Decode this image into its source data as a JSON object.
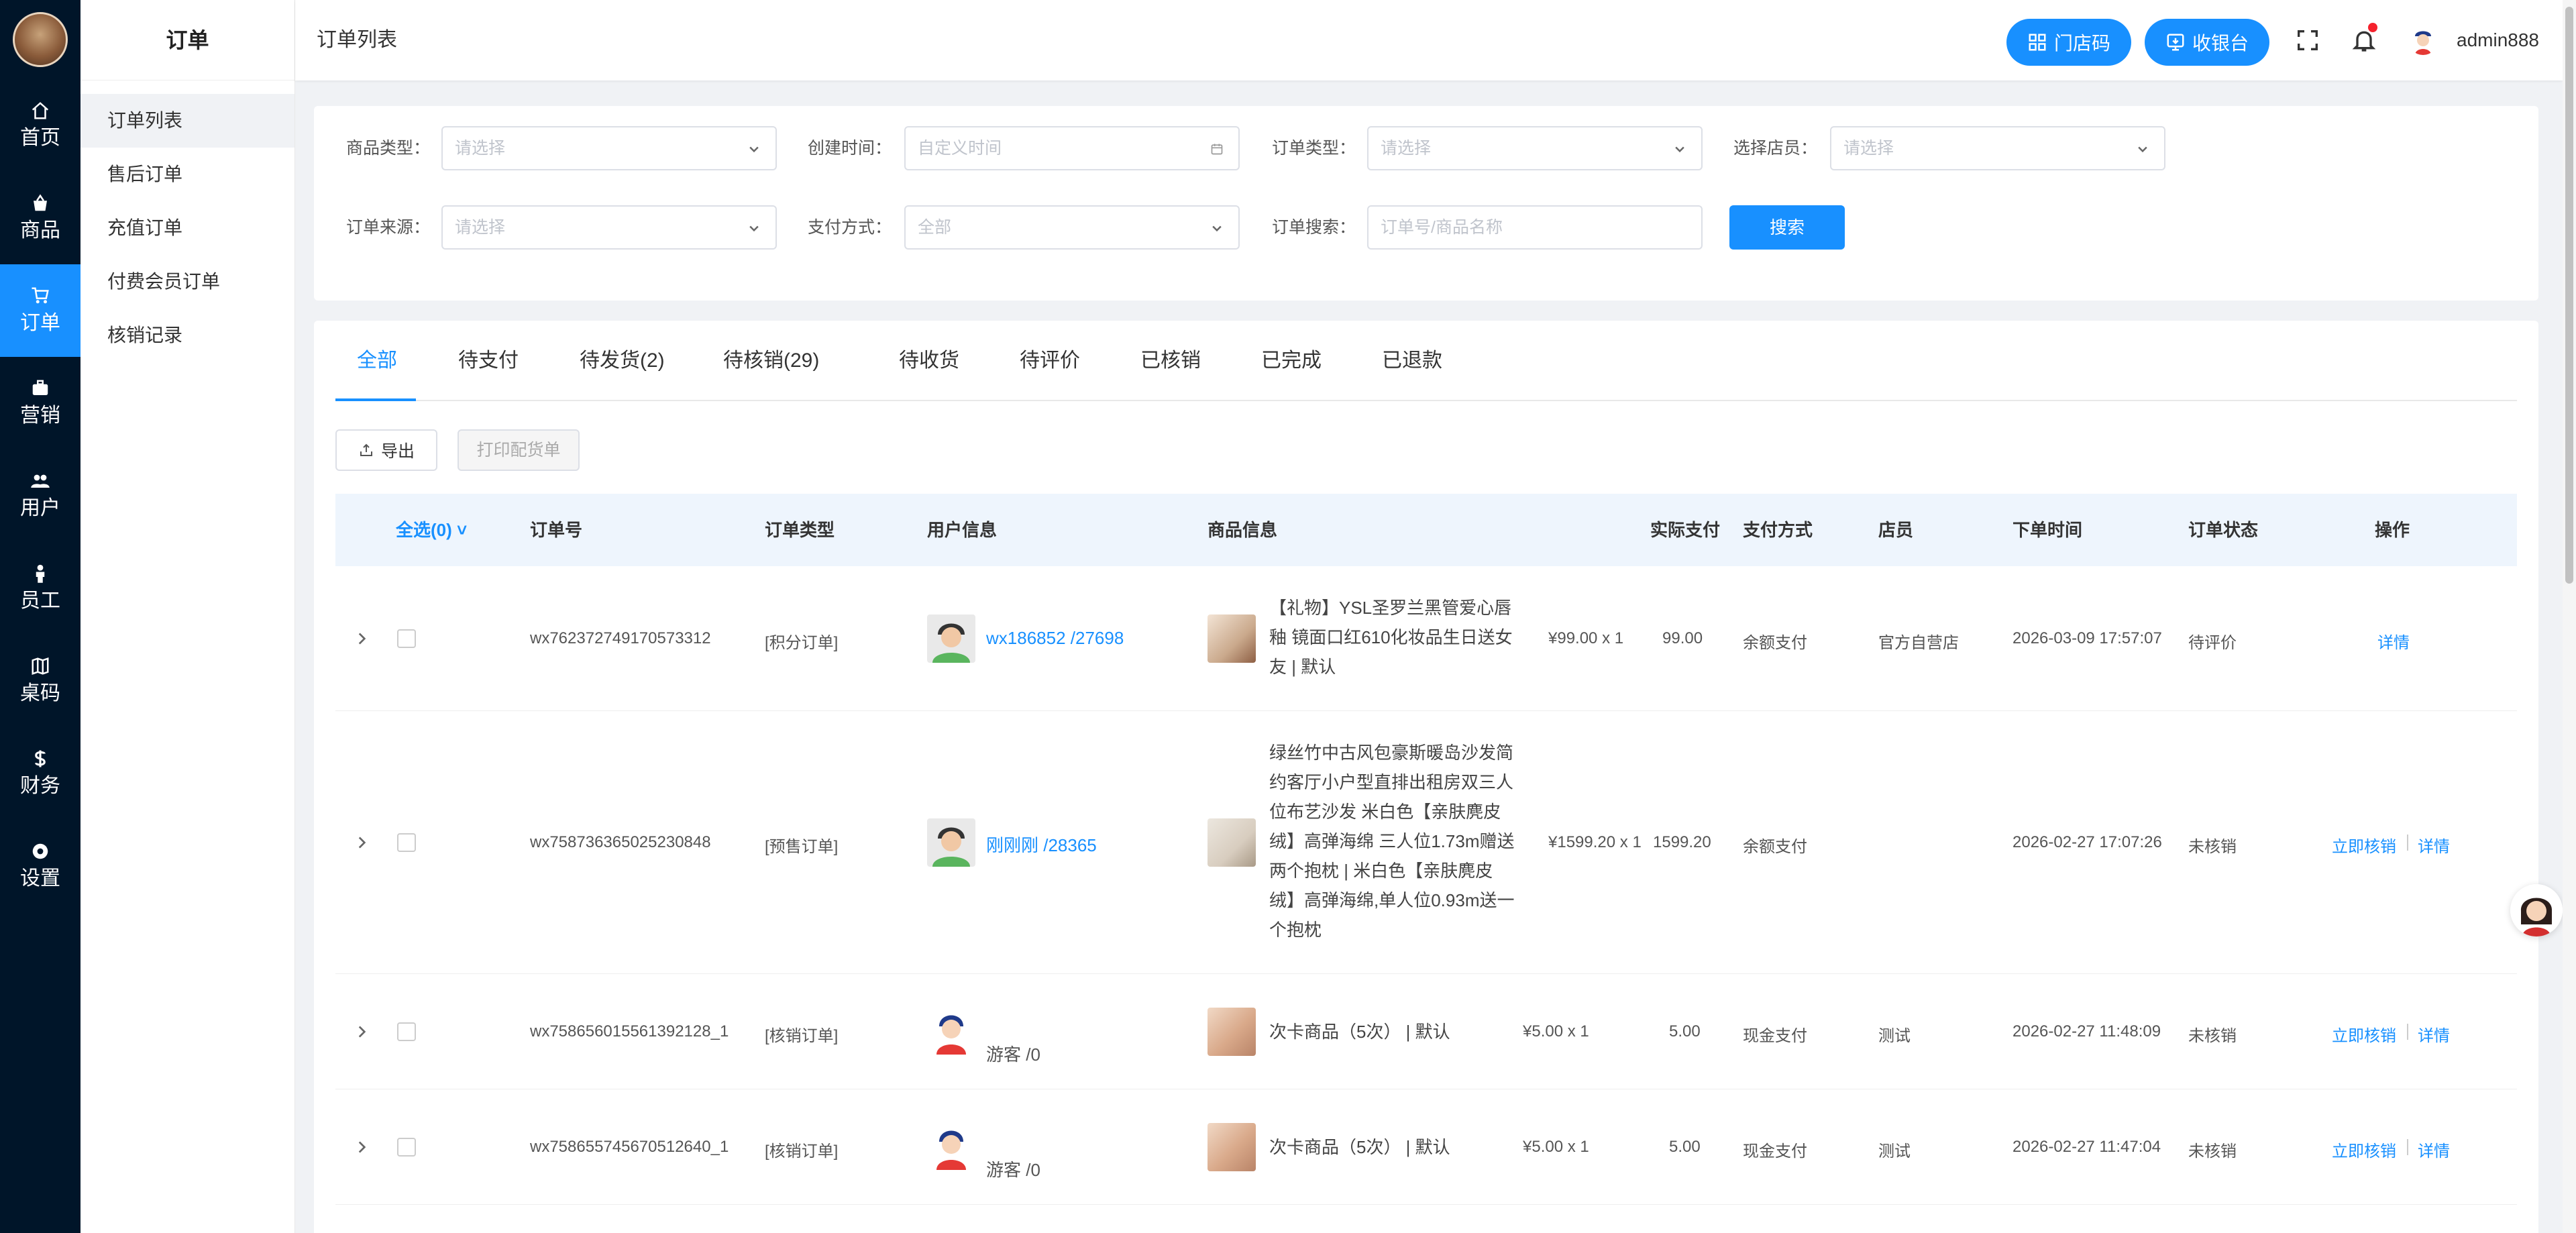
{
  "app": {
    "section_title": "订单",
    "page_title": "订单列表"
  },
  "sidebar": {
    "items": [
      {
        "label": "首页",
        "icon": "home-icon"
      },
      {
        "label": "商品",
        "icon": "shopping-bag-icon"
      },
      {
        "label": "订单",
        "icon": "cart-icon",
        "active": true
      },
      {
        "label": "营销",
        "icon": "briefcase-icon"
      },
      {
        "label": "用户",
        "icon": "users-icon"
      },
      {
        "label": "员工",
        "icon": "person-icon"
      },
      {
        "label": "桌码",
        "icon": "map-icon"
      },
      {
        "label": "财务",
        "icon": "dollar-icon"
      },
      {
        "label": "设置",
        "icon": "settings-icon"
      }
    ]
  },
  "subnav": {
    "items": [
      {
        "label": "订单列表",
        "active": true
      },
      {
        "label": "售后订单"
      },
      {
        "label": "充值订单"
      },
      {
        "label": "付费会员订单"
      },
      {
        "label": "核销记录"
      }
    ]
  },
  "header": {
    "store_code_label": "门店码",
    "cashier_label": "收银台",
    "username": "admin888"
  },
  "filters": {
    "product_type_label": "商品类型：",
    "product_type_placeholder": "请选择",
    "created_time_label": "创建时间：",
    "created_time_placeholder": "自定义时间",
    "order_type_label": "订单类型：",
    "order_type_placeholder": "请选择",
    "clerk_label": "选择店员：",
    "clerk_placeholder": "请选择",
    "source_label": "订单来源：",
    "source_placeholder": "请选择",
    "pay_method_label": "支付方式：",
    "pay_method_value": "全部",
    "search_label": "订单搜索：",
    "search_placeholder": "订单号/商品名称",
    "search_button": "搜索"
  },
  "tabs": [
    "全部",
    "待支付",
    "待发货(2)",
    "待核销(29)",
    "待收货",
    "待评价",
    "已核销",
    "已完成",
    "已退款"
  ],
  "actions": {
    "export": "导出",
    "print": "打印配货单"
  },
  "table": {
    "columns": {
      "select_all": "全选(0)",
      "order_no": "订单号",
      "order_type": "订单类型",
      "user_info": "用户信息",
      "product_info": "商品信息",
      "paid": "实际支付",
      "pay_method": "支付方式",
      "clerk": "店员",
      "time": "下单时间",
      "status": "订单状态",
      "ops": "操作"
    },
    "rows": [
      {
        "order_no": "wx762372749170573312",
        "order_type": "[积分订单]",
        "user": "wx186852 /27698",
        "product_lines": [
          "【礼物】YSL圣罗兰黑管爱心唇",
          "釉 镜面口红610化妆品生日送女",
          "友 | 默认"
        ],
        "price_qty": "¥99.00 x 1",
        "paid": "99.00",
        "pay_method": "余额支付",
        "clerk": "官方自营店",
        "time": "2026-03-09 17:57:07",
        "status": "待评价",
        "op_writeoff": "",
        "op_detail": "详情"
      },
      {
        "order_no": "wx758736365025230848",
        "order_type": "[预售订单]",
        "user": "刚刚刚 /28365",
        "product_lines": [
          "绿丝竹中古风包豪斯暖岛沙发简",
          "约客厅小户型直排出租房双三人",
          "位布艺沙发 米白色【亲肤麂皮",
          "绒】高弹海绵 三人位1.73m赠送",
          "两个抱枕 | 米白色【亲肤麂皮",
          "绒】高弹海绵,单人位0.93m送一",
          "个抱枕"
        ],
        "price_qty": "¥1599.20 x 1",
        "paid": "1599.20",
        "pay_method": "余额支付",
        "clerk": "",
        "time": "2026-02-27 17:07:26",
        "status": "未核销",
        "op_writeoff": "立即核销",
        "op_detail": "详情"
      },
      {
        "order_no": "wx758656015561392128_1",
        "order_type": "[核销订单]",
        "user": "游客 /0",
        "product_lines": [
          "次卡商品（5次） | 默认"
        ],
        "price_qty": "¥5.00 x 1",
        "paid": "5.00",
        "pay_method": "现金支付",
        "clerk": "测试",
        "time": "2026-02-27 11:48:09",
        "status": "未核销",
        "op_writeoff": "立即核销",
        "op_detail": "详情"
      },
      {
        "order_no": "wx758655745670512640_1",
        "order_type": "[核销订单]",
        "user": "游客 /0",
        "product_lines": [
          "次卡商品（5次） | 默认"
        ],
        "price_qty": "¥5.00 x 1",
        "paid": "5.00",
        "pay_method": "现金支付",
        "clerk": "测试",
        "time": "2026-02-27 11:47:04",
        "status": "未核销",
        "op_writeoff": "立即核销",
        "op_detail": "详情"
      }
    ]
  },
  "colors": {
    "primary": "#1890ff",
    "sidebar_bg": "#001529",
    "header_row_bg": "#eef5fd"
  }
}
